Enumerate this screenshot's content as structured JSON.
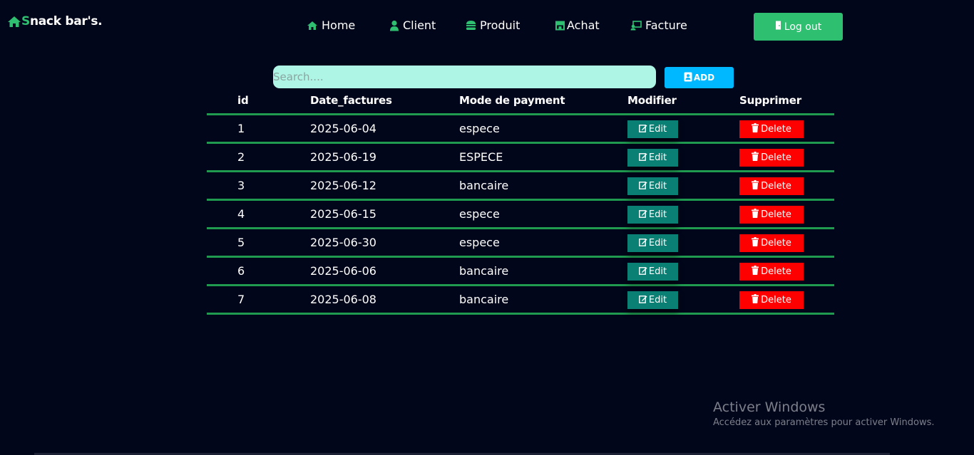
{
  "brand": {
    "initial": "S",
    "rest": "nack bar's."
  },
  "nav": [
    {
      "label": "Home",
      "icon": "home-icon"
    },
    {
      "label": "Client",
      "icon": "user-icon"
    },
    {
      "label": "Produit",
      "icon": "burger-icon"
    },
    {
      "label": "Achat",
      "icon": "store-icon"
    },
    {
      "label": "Facture",
      "icon": "invoice-icon"
    }
  ],
  "logout": {
    "label": "Log out",
    "icon": "door-icon"
  },
  "search": {
    "placeholder": "Search...."
  },
  "add": {
    "label": "ADD",
    "icon": "contact-book-icon"
  },
  "table": {
    "headers": [
      "id",
      "Date_factures",
      "Mode de payment",
      "Modifier",
      "Supprimer"
    ],
    "rows": [
      {
        "id": "1",
        "date": "2025-06-04",
        "mode": "espece"
      },
      {
        "id": "2",
        "date": "2025-06-19",
        "mode": "ESPECE"
      },
      {
        "id": "3",
        "date": "2025-06-12",
        "mode": "bancaire"
      },
      {
        "id": "4",
        "date": "2025-06-15",
        "mode": "espece"
      },
      {
        "id": "5",
        "date": "2025-06-30",
        "mode": "espece"
      },
      {
        "id": "6",
        "date": "2025-06-06",
        "mode": "bancaire"
      },
      {
        "id": "7",
        "date": "2025-06-08",
        "mode": "bancaire"
      }
    ],
    "edit_label": "Edit",
    "delete_label": "Delete"
  },
  "watermark": {
    "title": "Activer Windows",
    "subtitle": "Accédez aux paramètres pour activer Windows."
  },
  "colors": {
    "background": "#02061a",
    "accent": "#2fbf71",
    "search_bg": "#aef5e6",
    "add": "#00b8ff",
    "edit": "#0a7f73",
    "delete": "#ff0000",
    "row_line": "#1f9a4f"
  }
}
